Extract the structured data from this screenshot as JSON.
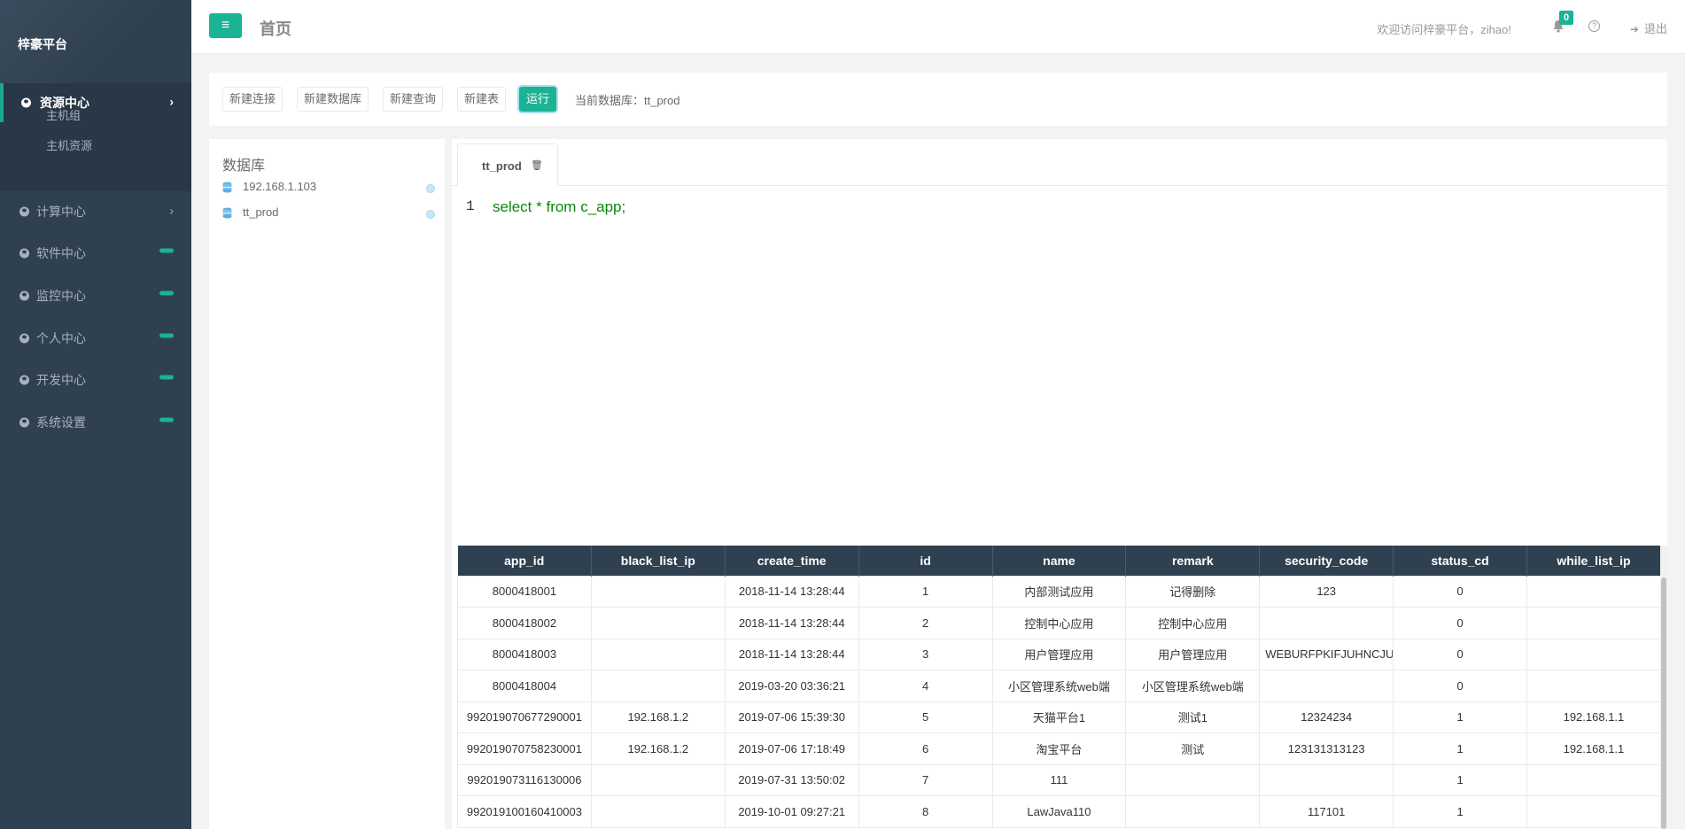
{
  "app": {
    "brand": "梓豪平台"
  },
  "header": {
    "page_title": "首页",
    "welcome": "欢迎访问梓豪平台，zihao!",
    "notification_count": "0",
    "logout_label": "退出"
  },
  "sidebar": {
    "active": {
      "label": "资源中心",
      "children": [
        "主机组",
        "主机资源"
      ]
    },
    "items": [
      {
        "label": "计算中心",
        "indicator": "arrow"
      },
      {
        "label": "软件中心",
        "indicator": "pill"
      },
      {
        "label": "监控中心",
        "indicator": "pill"
      },
      {
        "label": "个人中心",
        "indicator": "pill"
      },
      {
        "label": "开发中心",
        "indicator": "pill"
      },
      {
        "label": "系统设置",
        "indicator": "pill"
      }
    ]
  },
  "toolbar": {
    "buttons": [
      "新建连接",
      "新建数据库",
      "新建查询",
      "新建表",
      "运行"
    ],
    "current_db": "当前数据库：tt_prod"
  },
  "db_panel": {
    "title": "数据库",
    "items": [
      "192.168.1.103",
      "tt_prod"
    ]
  },
  "editor": {
    "tab_label": "tt_prod",
    "line_number": "1",
    "code": "select * from c_app;"
  },
  "results": {
    "columns": [
      "app_id",
      "black_list_ip",
      "create_time",
      "id",
      "name",
      "remark",
      "security_code",
      "status_cd",
      "while_list_ip"
    ],
    "rows": [
      [
        "8000418001",
        "",
        "2018-11-14 13:28:44",
        "1",
        "内部测试应用",
        "记得删除",
        "123",
        "0",
        ""
      ],
      [
        "8000418002",
        "",
        "2018-11-14 13:28:44",
        "2",
        "控制中心应用",
        "控制中心应用",
        "",
        "0",
        ""
      ],
      [
        "8000418003",
        "",
        "2018-11-14 13:28:44",
        "3",
        "用户管理应用",
        "用户管理应用",
        "WEBURFPKIFJUHNCJUI",
        "0",
        ""
      ],
      [
        "8000418004",
        "",
        "2019-03-20 03:36:21",
        "4",
        "小区管理系统web端",
        "小区管理系统web端",
        "",
        "0",
        ""
      ],
      [
        "992019070677290001",
        "192.168.1.2",
        "2019-07-06 15:39:30",
        "5",
        "天猫平台1",
        "测试1",
        "12324234",
        "1",
        "192.168.1.1"
      ],
      [
        "992019070758230001",
        "192.168.1.2",
        "2019-07-06 17:18:49",
        "6",
        "淘宝平台",
        "测试",
        "123131313123",
        "1",
        "192.168.1.1"
      ],
      [
        "992019073116130006",
        "",
        "2019-07-31 13:50:02",
        "7",
        "111",
        "",
        "",
        "1",
        ""
      ],
      [
        "992019100160410003",
        "",
        "2019-10-01 09:27:21",
        "8",
        "LawJava110",
        "",
        "117101",
        "1",
        ""
      ]
    ]
  },
  "colors": {
    "sidebar_bg": "#2f4050",
    "accent": "#1ab394",
    "table_header_bg": "#2f4050",
    "code_text": "#0a8a0a"
  }
}
